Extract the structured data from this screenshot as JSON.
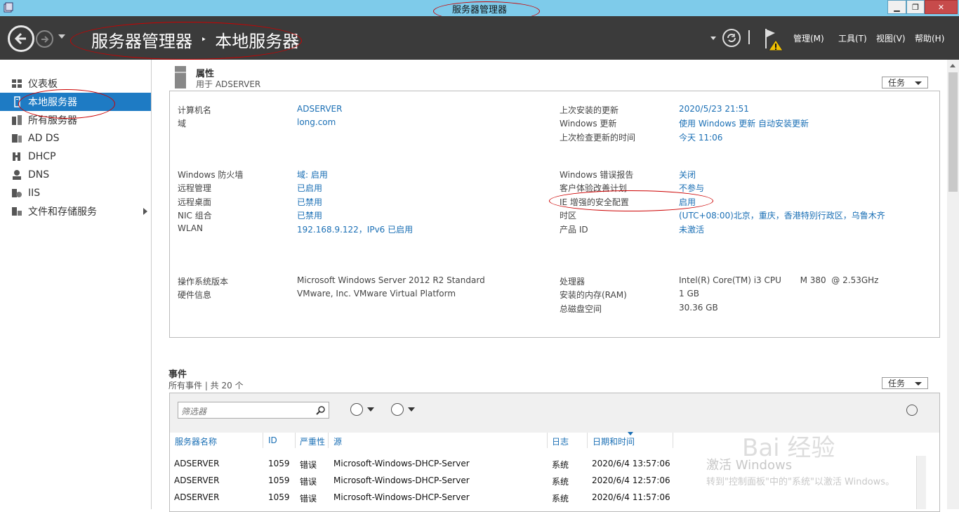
{
  "window": {
    "title": "服务器管理器",
    "controls": {
      "minimize": "▁",
      "restore": "❐",
      "close": "✕"
    }
  },
  "header": {
    "breadcrumb": {
      "root": "服务器管理器",
      "separator": "‣",
      "current": "本地服务器"
    },
    "menu": {
      "manage": "管理(M)",
      "tools": "工具(T)",
      "view": "视图(V)",
      "help": "帮助(H)"
    }
  },
  "sidebar": {
    "items": [
      {
        "label": "仪表板",
        "icon": "dashboard-icon"
      },
      {
        "label": "本地服务器",
        "icon": "server-icon",
        "active": true
      },
      {
        "label": "所有服务器",
        "icon": "servers-icon"
      },
      {
        "label": "AD DS",
        "icon": "adds-icon"
      },
      {
        "label": "DHCP",
        "icon": "dhcp-icon"
      },
      {
        "label": "DNS",
        "icon": "dns-icon"
      },
      {
        "label": "IIS",
        "icon": "iis-icon"
      },
      {
        "label": "文件和存储服务",
        "icon": "storage-icon"
      }
    ]
  },
  "properties": {
    "title": "属性",
    "subtitle": "用于 ADSERVER",
    "task_label": "任务",
    "left": {
      "computer_name": {
        "label": "计算机名",
        "value": "ADSERVER"
      },
      "domain": {
        "label": "域",
        "value": "long.com"
      },
      "firewall": {
        "label": "Windows 防火墙",
        "value": "域: 启用"
      },
      "remote_mgmt": {
        "label": "远程管理",
        "value": "已启用"
      },
      "remote_desktop": {
        "label": "远程桌面",
        "value": "已禁用"
      },
      "nic": {
        "label": "NIC 组合",
        "value": "已禁用"
      },
      "wlan": {
        "label": "WLAN",
        "value": "192.168.9.122，IPv6 已启用"
      },
      "os": {
        "label": "操作系统版本",
        "value": "Microsoft Windows Server 2012 R2 Standard"
      },
      "hw": {
        "label": "硬件信息",
        "value": "VMware, Inc. VMware Virtual Platform"
      }
    },
    "right": {
      "last_update": {
        "label": "上次安装的更新",
        "value": "2020/5/23 21:51"
      },
      "win_update": {
        "label": "Windows 更新",
        "value": "使用 Windows 更新 自动安装更新"
      },
      "last_check": {
        "label": "上次检查更新的时间",
        "value": "今天 11:06"
      },
      "error_report": {
        "label": "Windows 错误报告",
        "value": "关闭"
      },
      "ceip": {
        "label": "客户体验改善计划",
        "value": "不参与"
      },
      "ie_esc": {
        "label": "IE 增强的安全配置",
        "value": "启用"
      },
      "timezone": {
        "label": "时区",
        "value": "(UTC+08:00)北京，重庆，香港特别行政区，乌鲁木齐"
      },
      "product_id": {
        "label": "产品 ID",
        "value": "未激活"
      },
      "cpu": {
        "label": "处理器",
        "value": "Intel(R) Core(TM) i3 CPU       M 380  @ 2.53GHz"
      },
      "ram": {
        "label": "安装的内存(RAM)",
        "value": "1 GB"
      },
      "disk": {
        "label": "总磁盘空间",
        "value": "30.36 GB"
      }
    }
  },
  "events": {
    "title": "事件",
    "subtitle": "所有事件 | 共 20 个",
    "task_label": "任务",
    "filter_placeholder": "筛选器",
    "columns": [
      "服务器名称",
      "ID",
      "严重性",
      "源",
      "日志",
      "日期和时间"
    ],
    "rows": [
      [
        "ADSERVER",
        "1059",
        "错误",
        "Microsoft-Windows-DHCP-Server",
        "系统",
        "2020/6/4 13:57:06"
      ],
      [
        "ADSERVER",
        "1059",
        "错误",
        "Microsoft-Windows-DHCP-Server",
        "系统",
        "2020/6/4 12:57:06"
      ],
      [
        "ADSERVER",
        "1059",
        "错误",
        "Microsoft-Windows-DHCP-Server",
        "系统",
        "2020/6/4 11:57:06"
      ]
    ]
  },
  "watermark": {
    "activate_title": "激活 Windows",
    "activate_sub": "转到\"控制面板\"中的\"系统\"以激活 Windows。",
    "baidu": "Bai 经验"
  },
  "colors": {
    "accent": "#1e7bc4",
    "header_bg": "#3b3b3b",
    "titlebar": "#7ecbea",
    "link": "#1a6fb5"
  }
}
